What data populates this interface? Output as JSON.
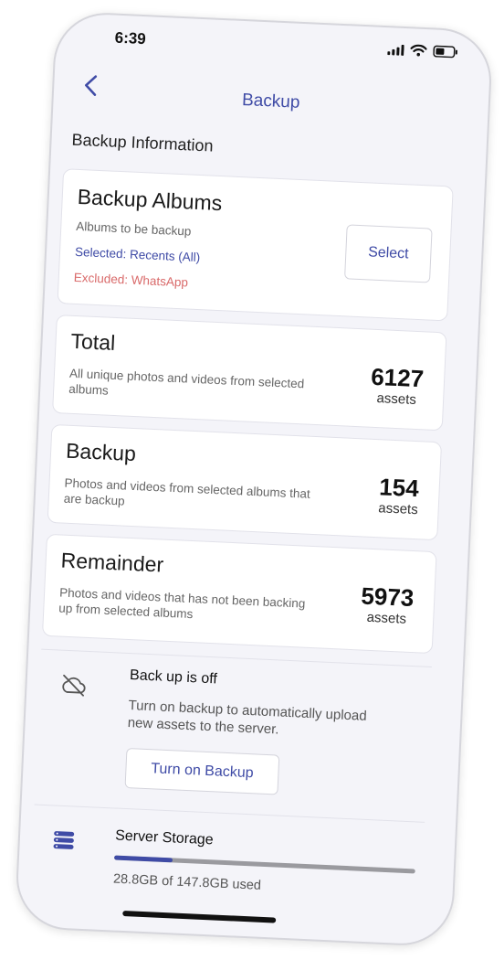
{
  "status_bar": {
    "time": "6:39"
  },
  "nav": {
    "title": "Backup"
  },
  "section": {
    "heading": "Backup Information"
  },
  "albums_card": {
    "title": "Backup Albums",
    "subtitle": "Albums to be backup",
    "selected": "Selected: Recents (All)",
    "excluded": "Excluded: WhatsApp",
    "select_button": "Select"
  },
  "total_card": {
    "title": "Total",
    "description": "All unique photos and videos from selected albums",
    "count": "6127",
    "unit": "assets"
  },
  "backup_card": {
    "title": "Backup",
    "description": "Photos and videos from selected albums that are backup",
    "count": "154",
    "unit": "assets"
  },
  "remainder_card": {
    "title": "Remainder",
    "description": "Photos and videos that has not been backing up from selected albums",
    "count": "5973",
    "unit": "assets"
  },
  "backup_status": {
    "icon": "cloud-off-icon",
    "title": "Back up is off",
    "description": "Turn on backup to automatically upload new assets to the server.",
    "button": "Turn on Backup"
  },
  "storage": {
    "icon": "server-storage-icon",
    "title": "Server Storage",
    "usage": "28.8GB of 147.8GB used",
    "used_fraction": 0.195
  },
  "colors": {
    "accent": "#3f4ba6",
    "excluded": "#d96a6a",
    "background": "#f4f4f9",
    "card": "#ffffff"
  }
}
